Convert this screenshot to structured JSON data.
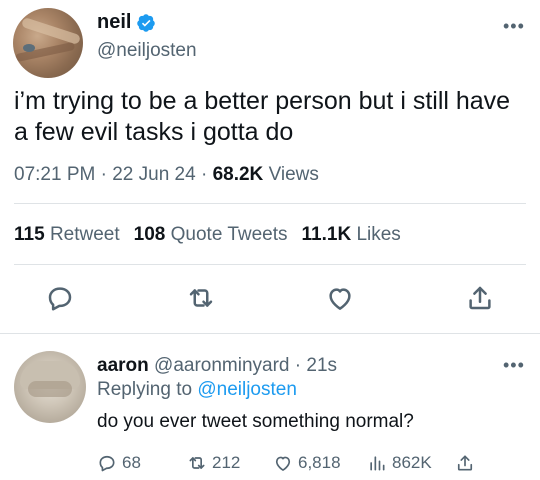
{
  "tweet": {
    "display_name": "neil",
    "handle": "@neiljosten",
    "more_icon": "more-dots-icon",
    "text": "i’m trying to be a better person but i still have a few evil tasks i gotta do",
    "time": "07:21 PM",
    "date": "22 Jun 24",
    "views_count": "68.2K",
    "views_label": "Views",
    "retweets_count": "115",
    "retweets_label": "Retweet",
    "quotes_count": "108",
    "quotes_label": "Quote Tweets",
    "likes_count": "11.1K",
    "likes_label": "Likes",
    "actions": [
      "reply-icon",
      "retweet-icon",
      "like-icon",
      "share-icon"
    ]
  },
  "reply": {
    "display_name": "aaron",
    "handle": "@aaronminyard",
    "age": "21s",
    "replying_prefix": "Replying to",
    "replying_handle": "@neiljosten",
    "text": "do you ever tweet something normal?",
    "reply_count": "68",
    "retweet_count": "212",
    "like_count": "6,818",
    "views_count": "862K"
  },
  "colors": {
    "accent": "#1d9bf0",
    "text": "#0f1419",
    "muted": "#536471",
    "divider": "#dfe3e6"
  }
}
